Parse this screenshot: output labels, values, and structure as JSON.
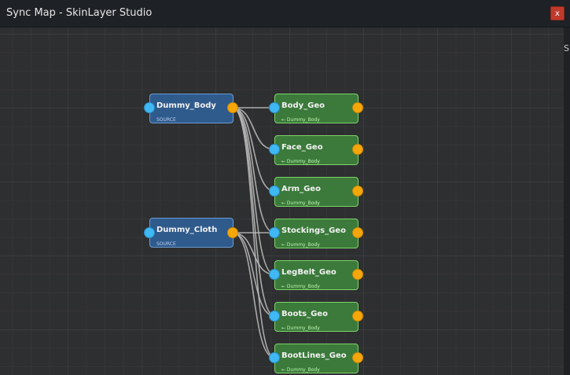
{
  "window": {
    "title": "Sync Map - SkinLayer Studio",
    "close_label": "x",
    "right_edge_text": "S"
  },
  "colors": {
    "source_node": "#2f5a8c",
    "target_node": "#3b7a3a",
    "input_port": "#3fb8f3",
    "output_port": "#f5a70a",
    "wire": "#b8b8b8"
  },
  "sources": [
    {
      "name": "Dummy_Body",
      "subtitle": "SOURCE"
    },
    {
      "name": "Dummy_Cloth",
      "subtitle": "SOURCE"
    }
  ],
  "targets": [
    {
      "name": "Body_Geo",
      "subtitle": "← Dummy_Body"
    },
    {
      "name": "Face_Geo",
      "subtitle": "← Dummy_Body"
    },
    {
      "name": "Arm_Geo",
      "subtitle": "← Dummy_Body"
    },
    {
      "name": "Stockings_Geo",
      "subtitle": "← Dummy_Body"
    },
    {
      "name": "LegBelt_Geo",
      "subtitle": "← Dummy_Body"
    },
    {
      "name": "Boots_Geo",
      "subtitle": "← Dummy_Body"
    },
    {
      "name": "BootLines_Geo",
      "subtitle": "← Dummy_Body"
    }
  ]
}
